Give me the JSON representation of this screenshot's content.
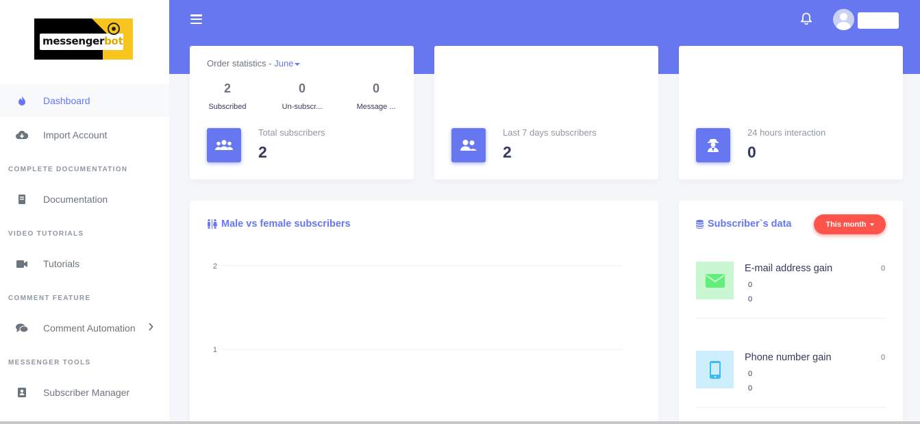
{
  "brand": {
    "logo_text_main": "messenger",
    "logo_text_accent": "bot"
  },
  "sidebar": {
    "items": [
      {
        "label": "Dashboard",
        "icon": "fire-icon"
      },
      {
        "label": "Import Account",
        "icon": "cloud-download-icon"
      },
      {
        "label": "Documentation",
        "icon": "book-icon"
      },
      {
        "label": "Tutorials",
        "icon": "video-camera-icon"
      },
      {
        "label": "Comment Automation",
        "icon": "comments-icon"
      },
      {
        "label": "Subscriber Manager",
        "icon": "contact-card-icon"
      }
    ],
    "headers": [
      "COMPLETE DOCUMENTATION",
      "VIDEO TUTORIALS",
      "COMMENT FEATURE",
      "MESSENGER TOOLS"
    ]
  },
  "topbar": {
    "menu_icon": "hamburger-icon",
    "bell_icon": "bell-icon",
    "avatar_icon": "user-avatar-icon"
  },
  "order_stats": {
    "title": "Order statistics - ",
    "month": "June",
    "mini": [
      {
        "value": "2",
        "label": "Subscribed"
      },
      {
        "value": "0",
        "label": "Un-subscr..."
      },
      {
        "value": "0",
        "label": "Message ..."
      }
    ],
    "total_label": "Total subscribers",
    "total_value": "2"
  },
  "last7": {
    "label": "Last 7 days subscribers",
    "value": "2"
  },
  "interaction": {
    "label": "24 hours interaction",
    "value": "0"
  },
  "gender_chart": {
    "title": "Male vs female subscribers"
  },
  "subscriber_data": {
    "title": "Subscriber`s data",
    "filter": "This month",
    "rows": [
      {
        "title": "E-mail address gain",
        "right": "0",
        "a": "0",
        "b": "0",
        "color": "#63ed7a"
      },
      {
        "title": "Phone number gain",
        "right": "0",
        "a": "0",
        "b": "0",
        "color": "#3abaf4"
      }
    ]
  },
  "colors": {
    "primary": "#6777ef",
    "danger": "#fc544b",
    "success": "#63ed7a",
    "info": "#3abaf4"
  },
  "chart_data": {
    "type": "bar",
    "title": "Male vs female subscribers",
    "categories": [],
    "series": [],
    "yticks": [
      1,
      2
    ],
    "ylim": [
      0,
      2
    ],
    "grid": true
  }
}
